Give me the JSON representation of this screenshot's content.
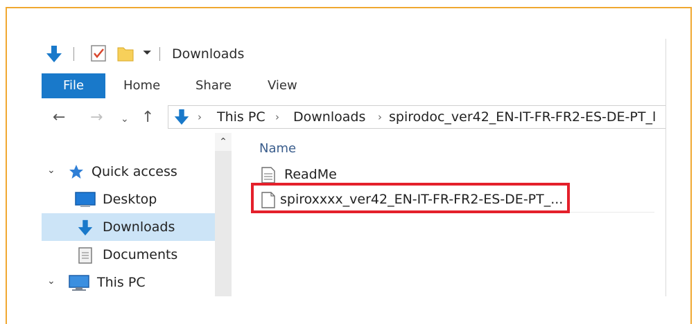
{
  "window": {
    "title": "Downloads"
  },
  "ribbon": {
    "tabs": [
      "File",
      "Home",
      "Share",
      "View"
    ]
  },
  "address": {
    "crumbs": [
      "This PC",
      "Downloads",
      "spirodoc_ver42_EN-IT-FR-FR2-ES-DE-PT_l"
    ]
  },
  "nav_pane": {
    "items": [
      {
        "label": "Quick access",
        "icon": "star-icon"
      },
      {
        "label": "Desktop",
        "icon": "desktop-icon"
      },
      {
        "label": "Downloads",
        "icon": "download-arrow-icon",
        "selected": true
      },
      {
        "label": "Documents",
        "icon": "documents-icon"
      },
      {
        "label": "This PC",
        "icon": "computer-icon"
      }
    ]
  },
  "content": {
    "column_header": "Name",
    "files": [
      {
        "name": "ReadMe",
        "icon": "text-file-icon"
      },
      {
        "name": "spiroxxxx_ver42_EN-IT-FR-FR2-ES-DE-PT_...",
        "icon": "file-icon",
        "highlighted": true
      }
    ]
  },
  "colors": {
    "accent": "#1979ca",
    "highlight": "#e4202b",
    "frame": "#f0a830",
    "selection": "#cce4f7"
  }
}
